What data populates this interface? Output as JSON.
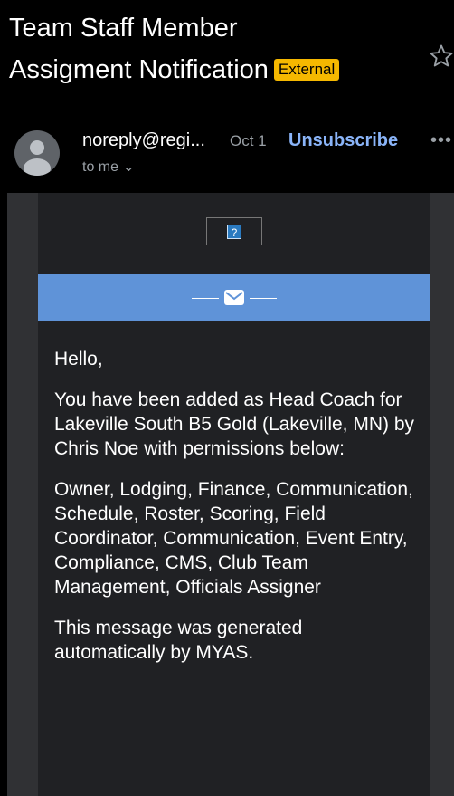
{
  "subject": {
    "line1": "Team Staff Member",
    "line2": "Assigment Notification",
    "badge": "External"
  },
  "header": {
    "sender": "noreply@regi...",
    "date": "Oct 1",
    "unsubscribe_label": "Unsubscribe",
    "more_label": "•••",
    "recipient": "to me",
    "recipient_chevron": "⌄"
  },
  "email": {
    "image_placeholder": "?",
    "greeting": "Hello,",
    "paragraph1": "You have been added as Head Coach for Lakeville South B5 Gold (Lakeville, MN) by Chris Noe with permissions below:",
    "paragraph2": "Owner, Lodging, Finance, Communication, Schedule, Roster, Scoring, Field Coordinator, Communication, Event Entry, Compliance, CMS, Club Team Management, Officials Assigner",
    "paragraph3": "This message was generated automatically by MYAS."
  },
  "icons": {
    "star": "star-icon",
    "avatar": "person-avatar-icon",
    "envelope": "envelope-icon",
    "more": "more-horizontal-icon"
  },
  "colors": {
    "background": "#000000",
    "badge": "#f5b800",
    "link": "#8ab4f8",
    "banner": "#5f93d8",
    "email_body": "#202124"
  }
}
